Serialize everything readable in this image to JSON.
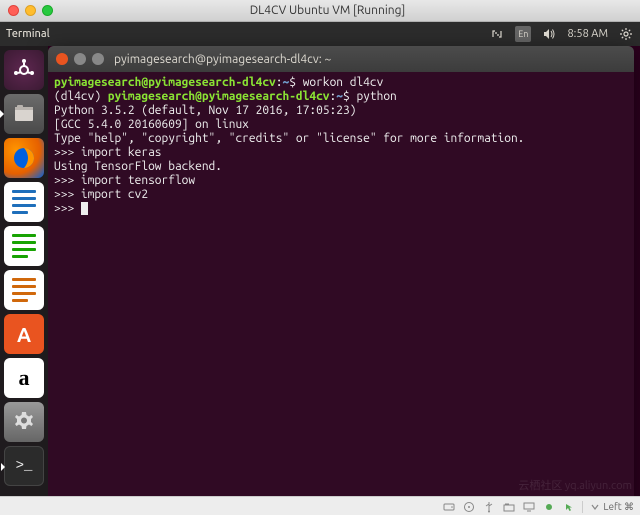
{
  "mac": {
    "window_title": "DL4CV Ubuntu VM [Running]"
  },
  "ubuntu_panel": {
    "app_title": "Terminal",
    "language": "En",
    "time": "8:58 AM"
  },
  "launcher": {
    "items": [
      {
        "name": "dash",
        "label": "Search"
      },
      {
        "name": "files",
        "label": "Files"
      },
      {
        "name": "firefox",
        "label": "Firefox"
      },
      {
        "name": "writer",
        "label": "LibreOffice Writer"
      },
      {
        "name": "calc",
        "label": "LibreOffice Calc"
      },
      {
        "name": "impress",
        "label": "LibreOffice Impress"
      },
      {
        "name": "software",
        "label": "Ubuntu Software",
        "glyph": "A"
      },
      {
        "name": "amazon",
        "label": "Amazon",
        "glyph": "a"
      },
      {
        "name": "settings",
        "label": "System Settings"
      },
      {
        "name": "terminal",
        "label": "Terminal",
        "glyph": ">_"
      }
    ]
  },
  "terminal": {
    "title_user": "pyimagesearch@pyimagesearch-dl4cv",
    "title_path": "~",
    "lines": {
      "l1_user": "pyimagesearch@pyimagesearch-dl4cv",
      "l1_path": "~",
      "l1_cmd": "workon dl4cv",
      "l2_venv": "(dl4cv) ",
      "l2_user": "pyimagesearch@pyimagesearch-dl4cv",
      "l2_path": "~",
      "l2_cmd": "python",
      "l3": "Python 3.5.2 (default, Nov 17 2016, 17:05:23)",
      "l4": "[GCC 5.4.0 20160609] on linux",
      "l5": "Type \"help\", \"copyright\", \"credits\" or \"license\" for more information.",
      "l6": ">>> import keras",
      "l7": "Using TensorFlow backend.",
      "l8": ">>> import tensorflow",
      "l9": ">>> import cv2",
      "l10": ">>> "
    }
  },
  "vbox": {
    "hostkey": "Left ⌘"
  },
  "watermark": "云栖社区  yq.aliyun.com"
}
